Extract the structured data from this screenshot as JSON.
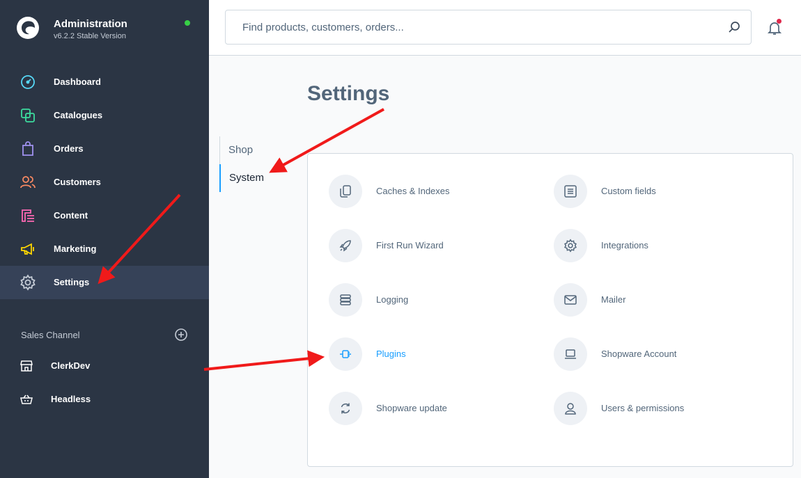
{
  "brand": {
    "title": "Administration",
    "version": "v6.2.2 Stable Version"
  },
  "nav": [
    {
      "label": "Dashboard",
      "icon": "dashboard-icon",
      "color": "#57d9f7"
    },
    {
      "label": "Catalogues",
      "icon": "catalogues-icon",
      "color": "#3cdc9e"
    },
    {
      "label": "Orders",
      "icon": "orders-icon",
      "color": "#a092f0"
    },
    {
      "label": "Customers",
      "icon": "customers-icon",
      "color": "#f88962"
    },
    {
      "label": "Content",
      "icon": "content-icon",
      "color": "#ff68b4"
    },
    {
      "label": "Marketing",
      "icon": "marketing-icon",
      "color": "#ffd700"
    },
    {
      "label": "Settings",
      "icon": "gear-icon",
      "color": "#c5ccd6",
      "active": true
    }
  ],
  "sales_channel": {
    "header": "Sales Channel",
    "items": [
      {
        "label": "ClerkDev",
        "icon": "storefront-icon"
      },
      {
        "label": "Headless",
        "icon": "basket-icon"
      }
    ]
  },
  "search": {
    "placeholder": "Find products, customers, orders..."
  },
  "page": {
    "title": "Settings"
  },
  "tabs": [
    "Shop",
    "System"
  ],
  "settings": [
    {
      "label": "Caches & Indexes",
      "icon": "copy-icon"
    },
    {
      "label": "Custom fields",
      "icon": "list-icon"
    },
    {
      "label": "First Run Wizard",
      "icon": "rocket-icon"
    },
    {
      "label": "Integrations",
      "icon": "gear-icon"
    },
    {
      "label": "Logging",
      "icon": "database-icon"
    },
    {
      "label": "Mailer",
      "icon": "envelope-icon"
    },
    {
      "label": "Plugins",
      "icon": "plug-icon",
      "highlight": true
    },
    {
      "label": "Shopware Account",
      "icon": "laptop-icon"
    },
    {
      "label": "Shopware update",
      "icon": "sync-icon"
    },
    {
      "label": "Users & permissions",
      "icon": "user-icon"
    }
  ],
  "colors": {
    "sidebar": "#2b3544",
    "accent": "#189eff",
    "arrow": "#f01a1a"
  }
}
